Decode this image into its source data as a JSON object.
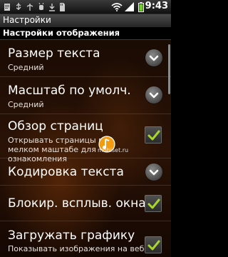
{
  "status_bar": {
    "time": "9:43",
    "icons": [
      "notification-icon",
      "usb-icon",
      "usb-debug-icon",
      "download-icon",
      "wifi-icon",
      "signal-icon",
      "battery-icon"
    ]
  },
  "title_bar": {
    "title": "Настройки"
  },
  "section": {
    "header": "Настройки отображения"
  },
  "settings": [
    {
      "title": "Размер текста",
      "summary": "Средний",
      "control": "dropdown"
    },
    {
      "title": "Масштаб по умолч.",
      "summary": "Средний",
      "control": "dropdown"
    },
    {
      "title": "Обзор страниц",
      "summary": "Открывать страницы в мелком маштабе для ознакомления",
      "control": "checkbox",
      "checked": true
    },
    {
      "title": "Кодировка текста",
      "summary": "",
      "control": "dropdown"
    },
    {
      "title": "Блокир. всплыв. окна",
      "summary": "",
      "control": "checkbox",
      "checked": true
    },
    {
      "title": "Загружать графику",
      "summary": "Показывать изображения на веб-",
      "control": "checkbox",
      "checked": true
    }
  ],
  "watermark": {
    "text": "mobiset.ru"
  },
  "colors": {
    "accent": "#f5a623",
    "background": "#2a1206",
    "check": "#9ccc2a"
  }
}
